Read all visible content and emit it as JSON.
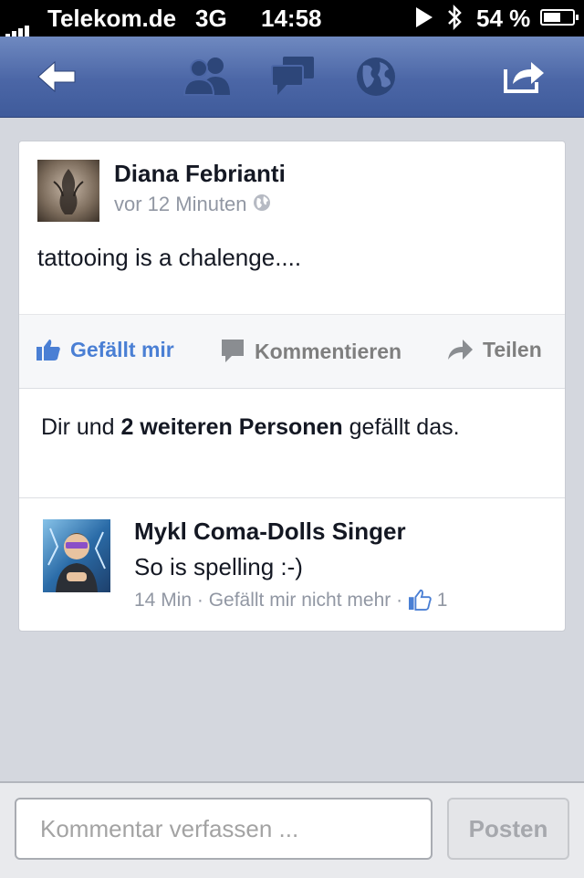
{
  "status_bar": {
    "carrier": "Telekom.de",
    "network": "3G",
    "time": "14:58",
    "battery": "54 %"
  },
  "nav": {
    "icons": [
      "back-arrow-icon",
      "friends-icon",
      "messages-icon",
      "globe-icon",
      "share-icon"
    ]
  },
  "post": {
    "author": "Diana Febrianti",
    "time": "vor 12 Minuten",
    "text": "tattooing is a chalenge...."
  },
  "actions": {
    "like_label": "Gefällt mir",
    "comment_label": "Kommentieren",
    "share_label": "Teilen"
  },
  "likes": {
    "prefix": "Dir und ",
    "bold": "2 weiteren Personen",
    "suffix": " gefällt das."
  },
  "comment": {
    "author": "Mykl Coma-Dolls Singer",
    "text": "So is spelling :-)",
    "time": "14 Min",
    "separator": " · ",
    "unlike_label": "Gefällt mir nicht mehr",
    "like_count": "1"
  },
  "composer": {
    "placeholder": "Kommentar verfassen ...",
    "post_label": "Posten"
  },
  "colors": {
    "nav_blue": "#4b66a6",
    "link_blue": "#4a7fd4",
    "background": "#d4d7de"
  }
}
